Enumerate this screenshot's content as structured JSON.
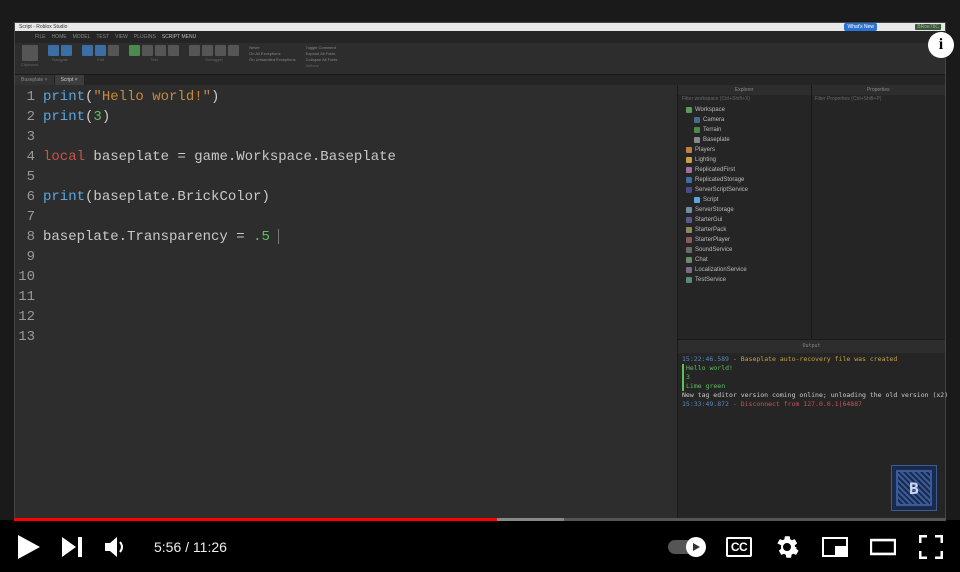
{
  "window": {
    "title": "Script - Roblox Studio",
    "buttons": {
      "min": "—",
      "max": "▢",
      "close": "✕"
    },
    "whatsnew": "What's New",
    "rightbadge": "BRoe78C"
  },
  "ribbon": {
    "tabs": [
      "FILE",
      "HOME",
      "MODEL",
      "TEST",
      "VIEW",
      "PLUGINS",
      "SCRIPT MENU"
    ],
    "active_tab": 6,
    "groups": {
      "clipboard": "Clipboard",
      "navigate": "Navigate",
      "edit": "Edit",
      "test": "Test",
      "debugger": "Debugger"
    },
    "dbg_items": [
      "Never",
      "On All Exceptions",
      "On Unhandled Exceptions"
    ],
    "fold_items": [
      "Toggle Comment",
      "Expand All Folds",
      "Collapse All Folds"
    ],
    "actions_label": "Actions"
  },
  "filetabs": {
    "tabs": [
      "Baseplate ×",
      "Script ×"
    ],
    "active": 1
  },
  "code": {
    "lines": 13,
    "l1_fn": "print",
    "l1_str": "\"Hello world!\"",
    "l2_fn": "print",
    "l2_num": "3",
    "l4_kw": "local",
    "l4_id1": "baseplate",
    "l4_eq": " = ",
    "l4_id2": "game.Workspace.Baseplate",
    "l6_fn": "print",
    "l6_arg": "baseplate.BrickColor",
    "l8_lhs": "baseplate.Transparency",
    "l8_eq": " = ",
    "l8_num": ".5"
  },
  "explorer": {
    "title": "Explorer",
    "filter": "Filter workspace (Ctrl+Shift+X)",
    "items": [
      {
        "label": "Workspace",
        "cls": "wk"
      },
      {
        "label": "Camera",
        "cls": "cam"
      },
      {
        "label": "Terrain",
        "cls": "ter"
      },
      {
        "label": "Baseplate",
        "cls": "bp"
      },
      {
        "label": "Players",
        "cls": "pl"
      },
      {
        "label": "Lighting",
        "cls": "lt"
      },
      {
        "label": "ReplicatedFirst",
        "cls": "rf"
      },
      {
        "label": "ReplicatedStorage",
        "cls": "rs"
      },
      {
        "label": "ServerScriptService",
        "cls": "ssc"
      },
      {
        "label": "Script",
        "cls": "scr"
      },
      {
        "label": "ServerStorage",
        "cls": "ss"
      },
      {
        "label": "StarterGui",
        "cls": "sg"
      },
      {
        "label": "StarterPack",
        "cls": "sp"
      },
      {
        "label": "StarterPlayer",
        "cls": "spl"
      },
      {
        "label": "SoundService",
        "cls": "sd"
      },
      {
        "label": "Chat",
        "cls": "ch"
      },
      {
        "label": "LocalizationService",
        "cls": "ls"
      },
      {
        "label": "TestService",
        "cls": "ts"
      }
    ]
  },
  "properties": {
    "title": "Properties",
    "filter": "Filter Properties (Ctrl+Shift+P)"
  },
  "output": {
    "title": "Output",
    "l1_time": "15:22:46.589",
    "l1_msg": " - Baseplate auto-recovery file was created",
    "l2": "Hello world!",
    "l3": "3",
    "l4": "Lime green",
    "l5": "New tag editor version coming online; unloading the old version (x2)",
    "l6_time": "15:33:49.872",
    "l6_msg": " - Disconnect from 127.0.0.1|64887"
  },
  "player": {
    "current": "5:56",
    "duration": "11:26",
    "cc": "CC",
    "info": "i",
    "logo": "B"
  }
}
